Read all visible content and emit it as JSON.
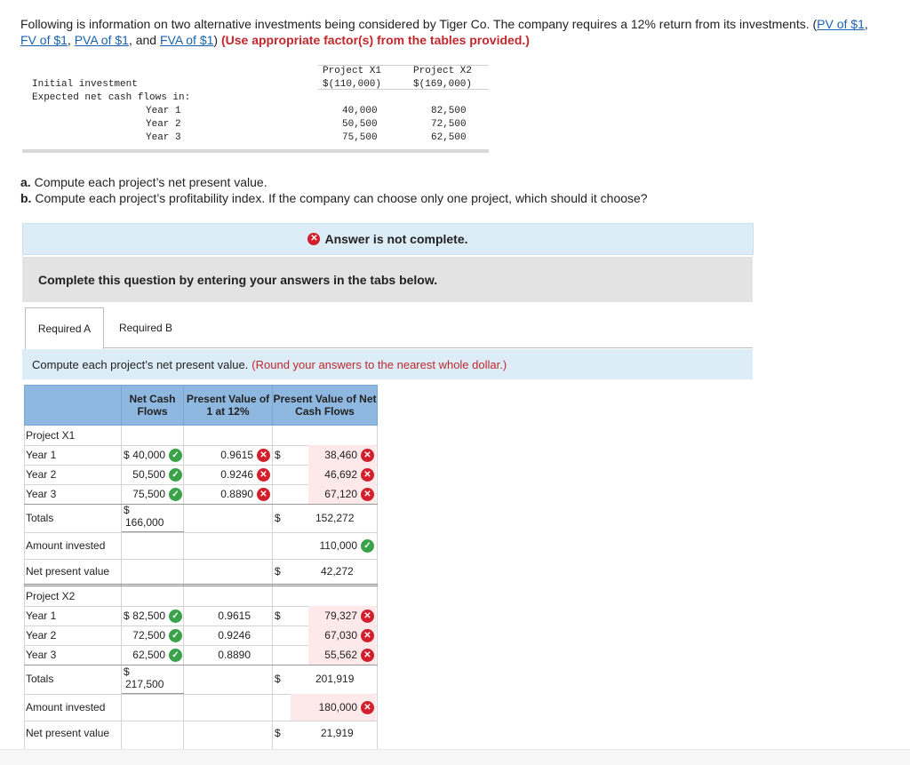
{
  "intro": {
    "text1": "Following is information on two alternative investments being considered by Tiger Co. The company requires a 12% return from its investments. (",
    "links": [
      "PV of $1",
      "FV of $1",
      "PVA of $1",
      "FVA of $1"
    ],
    "sep1": ", ",
    "sep3": ", and ",
    "text2": ") ",
    "hint": "(Use appropriate factor(s) from the tables provided.)"
  },
  "data_table": {
    "col1": "Project X1",
    "col2": "Project X2",
    "initial_label": "Initial investment",
    "initial_x1": "$(110,000)",
    "initial_x2": "$(169,000)",
    "flows_label": "Expected net cash flows in:",
    "years": [
      {
        "label": "Year 1",
        "x1": "40,000",
        "x2": "82,500"
      },
      {
        "label": "Year 2",
        "x1": "50,500",
        "x2": "72,500"
      },
      {
        "label": "Year 3",
        "x1": "75,500",
        "x2": "62,500"
      }
    ]
  },
  "questions": {
    "a_prefix": "a.",
    "a_text": " Compute each project’s net present value.",
    "b_prefix": "b.",
    "b_text": " Compute each project’s profitability index. If the company can choose only one project, which should it choose?"
  },
  "status": {
    "icon": "x-circle-icon",
    "answer_status": "Answer is not complete.",
    "complete_prompt": "Complete this question by entering your answers in the tabs below."
  },
  "tabs": [
    {
      "label": "Required A",
      "active": true
    },
    {
      "label": "Required B",
      "active": false
    }
  ],
  "instruction": {
    "text": "Compute each project’s net present value.",
    "hint": "(Round your answers to the nearest whole dollar.)"
  },
  "grid": {
    "headers": [
      "Net Cash Flows",
      "Present Value of 1 at 12%",
      "Present Value of Net Cash Flows"
    ],
    "x1": {
      "title": "Project X1",
      "rows": [
        {
          "label": "Year 1",
          "flow": "40,000",
          "factor": "0.9615",
          "pv": "38,460"
        },
        {
          "label": "Year 2",
          "flow": "50,500",
          "factor": "0.9246",
          "pv": "46,692"
        },
        {
          "label": "Year 3",
          "flow": "75,500",
          "factor": "0.8890",
          "pv": "67,120"
        }
      ],
      "totals_label": "Totals",
      "total_flow": "166,000",
      "total_pv": "152,272",
      "invested_label": "Amount invested",
      "invested": "110,000",
      "npv_label": "Net present value",
      "npv": "42,272"
    },
    "x2": {
      "title": "Project X2",
      "rows": [
        {
          "label": "Year 1",
          "flow": "82,500",
          "factor": "0.9615",
          "pv": "79,327"
        },
        {
          "label": "Year 2",
          "flow": "72,500",
          "factor": "0.9246",
          "pv": "67,030"
        },
        {
          "label": "Year 3",
          "flow": "62,500",
          "factor": "0.8890",
          "pv": "55,562"
        }
      ],
      "totals_label": "Totals",
      "total_flow": "217,500",
      "total_pv": "201,919",
      "invested_label": "Amount invested",
      "invested": "180,000",
      "npv_label": "Net present value",
      "npv": "21,919"
    },
    "currency": "$",
    "colors": {
      "header_bg": "#8fb8e0",
      "correct": "#3aa34a",
      "incorrect": "#d11f2c",
      "incorrect_bg": "#fde9ea"
    }
  }
}
